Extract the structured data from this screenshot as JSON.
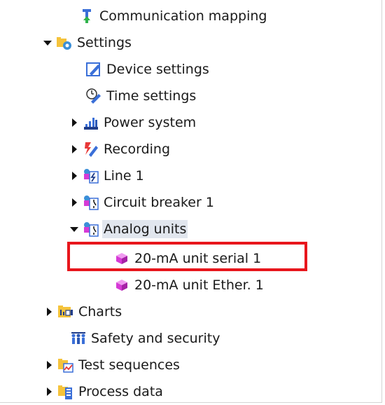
{
  "tree": {
    "items": [
      {
        "label": "Communication mapping",
        "toggle": "none",
        "icon": "communication-mapping-icon"
      },
      {
        "label": "Settings",
        "toggle": "expanded",
        "icon": "settings-folder-icon"
      },
      {
        "label": "Device settings",
        "toggle": "none",
        "icon": "device-settings-icon"
      },
      {
        "label": "Time settings",
        "toggle": "none",
        "icon": "time-settings-icon"
      },
      {
        "label": "Power system",
        "toggle": "collapsed",
        "icon": "power-system-icon"
      },
      {
        "label": "Recording",
        "toggle": "collapsed",
        "icon": "recording-icon"
      },
      {
        "label": "Line 1",
        "toggle": "collapsed",
        "icon": "line-icon"
      },
      {
        "label": "Circuit breaker 1",
        "toggle": "collapsed",
        "icon": "circuit-breaker-icon"
      },
      {
        "label": "Analog units",
        "toggle": "expanded",
        "icon": "analog-units-icon",
        "selected": true
      },
      {
        "label": "20-mA unit serial 1",
        "toggle": "none",
        "icon": "unit-cube-icon",
        "highlighted": true
      },
      {
        "label": "20-mA unit Ether. 1",
        "toggle": "none",
        "icon": "unit-cube-icon"
      },
      {
        "label": "Charts",
        "toggle": "collapsed",
        "icon": "charts-icon"
      },
      {
        "label": "Safety and security",
        "toggle": "none",
        "icon": "safety-security-icon"
      },
      {
        "label": "Test sequences",
        "toggle": "collapsed",
        "icon": "test-sequences-folder-icon"
      },
      {
        "label": "Process data",
        "toggle": "collapsed",
        "icon": "process-data-folder-icon"
      }
    ]
  },
  "colors": {
    "highlight_border": "#e8161c",
    "selected_background": "#e1e6ee",
    "folder_yellow": "#f5c33b",
    "cube_magenta": "#d63ad6"
  }
}
